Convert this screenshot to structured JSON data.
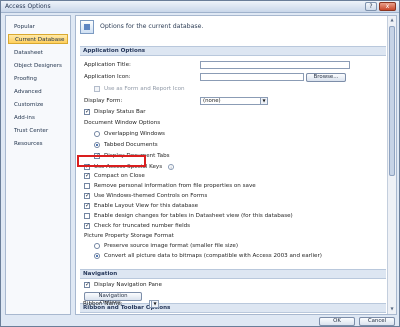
{
  "window": {
    "title": "Access Options",
    "help_label": "?",
    "close_label": "x"
  },
  "sidebar": {
    "items": [
      {
        "label": "Popular",
        "active": false
      },
      {
        "label": "Current Database",
        "active": true
      },
      {
        "label": "Datasheet",
        "active": false
      },
      {
        "label": "Object Designers",
        "active": false
      },
      {
        "label": "Proofing",
        "active": false
      },
      {
        "label": "Advanced",
        "active": false
      },
      {
        "label": "Customize",
        "active": false
      },
      {
        "label": "Add-ins",
        "active": false
      },
      {
        "label": "Trust Center",
        "active": false
      },
      {
        "label": "Resources",
        "active": false
      }
    ]
  },
  "header": {
    "text": "Options for the current database."
  },
  "sections": {
    "app_options": "Application Options",
    "navigation": "Navigation",
    "ribbon": "Ribbon and Toolbar Options"
  },
  "app_options": {
    "app_title_label": "Application Title:",
    "app_title_value": "",
    "app_icon_label": "Application Icon:",
    "app_icon_value": "",
    "browse_label": "Browse...",
    "use_as_form_label": "Use as Form and Report Icon",
    "display_form_label": "Display Form:",
    "display_form_value": "(none)",
    "display_status_bar_label": "Display Status Bar",
    "doc_window_options_label": "Document Window Options",
    "overlapping_label": "Overlapping Windows",
    "tabbed_label": "Tabbed Documents",
    "display_doc_tabs_label": "Display Document Tabs",
    "use_access_special_keys_label": "Use Access Special Keys",
    "compact_on_close_label": "Compact on Close",
    "remove_personal_info_label": "Remove personal information from file properties on save",
    "use_windows_themed_label": "Use Windows-themed Controls on Forms",
    "enable_layout_view_label": "Enable Layout View for this database",
    "enable_design_changes_label": "Enable design changes for tables in Datasheet view (for this database)",
    "check_truncated_label": "Check for truncated number fields",
    "picture_storage_label": "Picture Property Storage Format",
    "preserve_source_label": "Preserve source image format (smaller file size)",
    "convert_all_label": "Convert all picture data to bitmaps (compatible with Access 2003 and earlier)"
  },
  "navigation": {
    "display_nav_pane_label": "Display Navigation Pane",
    "nav_options_label": "Navigation Options..."
  },
  "ribbon": {
    "ribbon_name_label": "Ribbon Name:",
    "ribbon_name_value": ""
  },
  "footer": {
    "ok_label": "OK",
    "cancel_label": "Cancel"
  },
  "colors": {
    "highlight_box": "#d91e1e",
    "active_item": "#ffcf5c"
  }
}
